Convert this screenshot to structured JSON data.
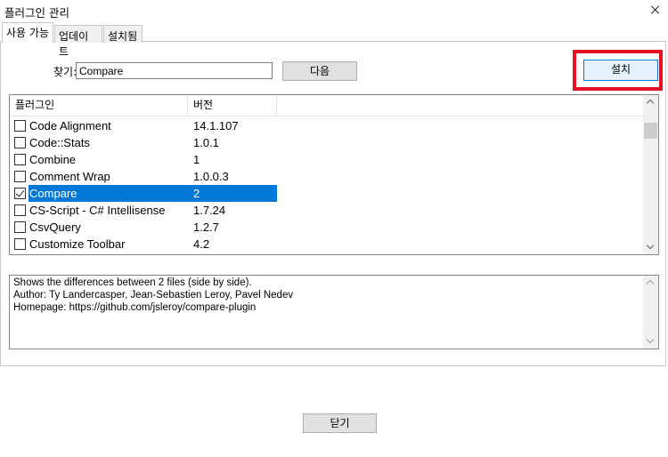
{
  "window": {
    "title": "플러그인 관리"
  },
  "tabs": [
    {
      "label": "사용 가능",
      "active": true
    },
    {
      "label": "업데이트",
      "active": false
    },
    {
      "label": "설치됨",
      "active": false
    }
  ],
  "search": {
    "label": "찾기:",
    "value": "Compare"
  },
  "buttons": {
    "next": "다음",
    "install": "설치",
    "close": "닫기"
  },
  "list": {
    "columns": [
      "플러그인",
      "버전"
    ],
    "rows": [
      {
        "name": "Code Alignment",
        "version": "14.1.107",
        "checked": false,
        "selected": false
      },
      {
        "name": "Code::Stats",
        "version": "1.0.1",
        "checked": false,
        "selected": false
      },
      {
        "name": "Combine",
        "version": "1",
        "checked": false,
        "selected": false
      },
      {
        "name": "Comment Wrap",
        "version": "1.0.0.3",
        "checked": false,
        "selected": false
      },
      {
        "name": "Compare",
        "version": "2",
        "checked": true,
        "selected": true
      },
      {
        "name": "CS-Script - C# Intellisense",
        "version": "1.7.24",
        "checked": false,
        "selected": false
      },
      {
        "name": "CsvQuery",
        "version": "1.2.7",
        "checked": false,
        "selected": false
      },
      {
        "name": "Customize Toolbar",
        "version": "4.2",
        "checked": false,
        "selected": false
      }
    ]
  },
  "description": {
    "lines": [
      "Shows the differences between 2 files (side by side).",
      "Author: Ty Landercasper, Jean-Sebastien Leroy, Pavel Nedev",
      "Homepage: https://github.com/jsleroy/compare-plugin"
    ]
  },
  "colors": {
    "selection": "#0078d7",
    "highlight_box": "#e81123"
  }
}
